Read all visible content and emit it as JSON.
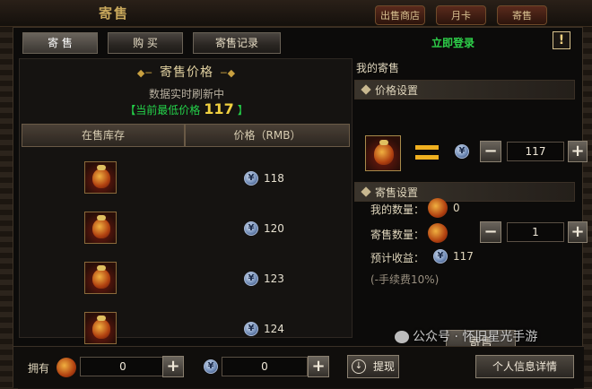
{
  "window": {
    "title": "寄售",
    "nav_stubs": [
      "出售商店",
      "月卡",
      "寄售"
    ]
  },
  "tabs": [
    {
      "label": "寄 售",
      "active": true
    },
    {
      "label": "购 买",
      "active": false
    },
    {
      "label": "寄售记录",
      "active": false
    }
  ],
  "header": {
    "login_link": "立即登录",
    "alert_icon": "!"
  },
  "market": {
    "title": "寄售价格",
    "refresh_note": "数据实时刷新中",
    "lowest_label_open": "【当前最低价格",
    "lowest_value": "117",
    "lowest_label_close": "】",
    "columns": [
      "在售库存",
      "价格（RMB）"
    ],
    "currency_icon": "yuan-coin-icon",
    "currency_glyph": "¥",
    "listings": [
      {
        "item_icon": "gold-pouch-icon",
        "price": "118"
      },
      {
        "item_icon": "gold-pouch-icon",
        "price": "120"
      },
      {
        "item_icon": "gold-pouch-icon",
        "price": "123"
      },
      {
        "item_icon": "gold-pouch-icon",
        "price": "124"
      }
    ]
  },
  "my_sale": {
    "title": "我的寄售",
    "price_section": "价格设置",
    "price_value": "117",
    "sale_section": "寄售设置",
    "my_qty_label": "我的数量：",
    "my_qty_value": "0",
    "sell_qty_label": "寄售数量：",
    "sell_qty_value": "1",
    "expected_label": "预计收益：",
    "expected_value": "117",
    "fee_note": "(-手续费10%)",
    "sell_button": "寄售"
  },
  "bottom": {
    "own_label": "拥有",
    "own_item_value": "0",
    "own_currency_value": "0",
    "withdraw_label": "提现",
    "detail_label": "个人信息详情"
  },
  "watermark": "公众号 · 怀旧星光手游",
  "colors": {
    "accent_green": "#2ed14a",
    "price_gold": "#f0d040",
    "equals_orange": "#f0b020"
  }
}
